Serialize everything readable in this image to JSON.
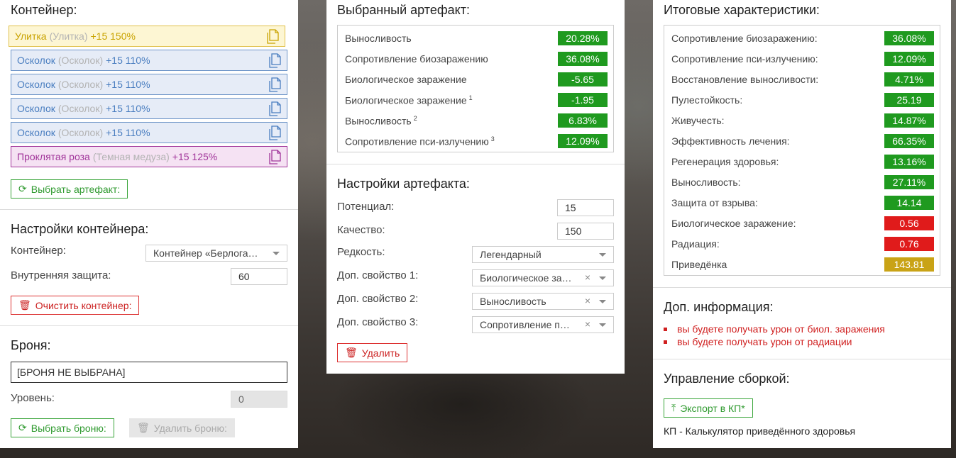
{
  "left": {
    "container_title": "Контейнер:",
    "items": [
      {
        "name": "Улитка",
        "alt": "(Улитка)",
        "bonus": "+15 150%"
      },
      {
        "name": "Осколок",
        "alt": "(Осколок)",
        "bonus": "+15 110%"
      },
      {
        "name": "Осколок",
        "alt": "(Осколок)",
        "bonus": "+15 110%"
      },
      {
        "name": "Осколок",
        "alt": "(Осколок)",
        "bonus": "+15 110%"
      },
      {
        "name": "Осколок",
        "alt": "(Осколок)",
        "bonus": "+15 110%"
      },
      {
        "name": "Проклятая роза",
        "alt": "(Темная медуза)",
        "bonus": "+15 125%"
      }
    ],
    "select_artifact_btn": "Выбрать артефакт:",
    "settings_title": "Настройки контейнера:",
    "container_label": "Контейнер:",
    "container_value": "Контейнер «Берлога…",
    "inner_protection_label": "Внутренняя защита:",
    "inner_protection_value": "60",
    "clear_btn": "Очистить контейнер:",
    "armor_title": "Броня:",
    "armor_value": "[БРОНЯ НЕ ВЫБРАНА]",
    "level_label": "Уровень:",
    "level_value": "0",
    "select_armor_btn": "Выбрать броню:",
    "delete_armor_btn": "Удалить броню:"
  },
  "middle": {
    "selected_title": "Выбранный артефакт:",
    "stats": [
      {
        "label": "Выносливость",
        "sup": "",
        "value": "20.28%"
      },
      {
        "label": "Сопротивление биозаражению",
        "sup": "",
        "value": "36.08%"
      },
      {
        "label": "Биологическое заражение",
        "sup": "",
        "value": "-5.65"
      },
      {
        "label": "Биологическое заражение",
        "sup": "1",
        "value": "-1.95"
      },
      {
        "label": "Выносливость",
        "sup": "2",
        "value": "6.83%"
      },
      {
        "label": "Сопротивление пси-излучению",
        "sup": "3",
        "value": "12.09%"
      }
    ],
    "settings_title": "Настройки артефакта:",
    "potential_label": "Потенциал:",
    "potential_value": "15",
    "quality_label": "Качество:",
    "quality_value": "150",
    "rarity_label": "Редкость:",
    "rarity_value": "Легендарный",
    "extra1_label": "Доп. свойство 1:",
    "extra1_value": "Биологическое за…",
    "extra2_label": "Доп. свойство 2:",
    "extra2_value": "Выносливость",
    "extra3_label": "Доп. свойство 3:",
    "extra3_value": "Сопротивление п…",
    "delete_btn": "Удалить"
  },
  "right": {
    "total_title": "Итоговые характеристики:",
    "totals": [
      {
        "label": "Сопротивление биозаражению:",
        "value": "36.08%",
        "color": "green"
      },
      {
        "label": "Сопротивление пси-излучению:",
        "value": "12.09%",
        "color": "green"
      },
      {
        "label": "Восстановление выносливости:",
        "value": "4.71%",
        "color": "green"
      },
      {
        "label": "Пулестойкость:",
        "value": "25.19",
        "color": "green"
      },
      {
        "label": "Живучесть:",
        "value": "14.87%",
        "color": "green"
      },
      {
        "label": "Эффективность лечения:",
        "value": "66.35%",
        "color": "green"
      },
      {
        "label": "Регенерация здоровья:",
        "value": "13.16%",
        "color": "green"
      },
      {
        "label": "Выносливость:",
        "value": "27.11%",
        "color": "green"
      },
      {
        "label": "Защита от взрыва:",
        "value": "14.14",
        "color": "green"
      },
      {
        "label": "Биологическое заражение:",
        "value": "0.56",
        "color": "red"
      },
      {
        "label": "Радиация:",
        "value": "0.76",
        "color": "red"
      },
      {
        "label": "Приведёнка",
        "value": "143.81",
        "color": "gold"
      }
    ],
    "info_title": "Доп. информация:",
    "info": [
      "вы будете получать урон от биол. заражения",
      "вы будете получать урон от радиации"
    ],
    "build_title": "Управление сборкой:",
    "export_btn": "Экспорт в КП*",
    "footnote": "КП - Калькулятор приведённого здоровья"
  },
  "colors": {
    "green": "#1f9a1f",
    "red": "#e01b1b",
    "gold": "#c9a316"
  }
}
